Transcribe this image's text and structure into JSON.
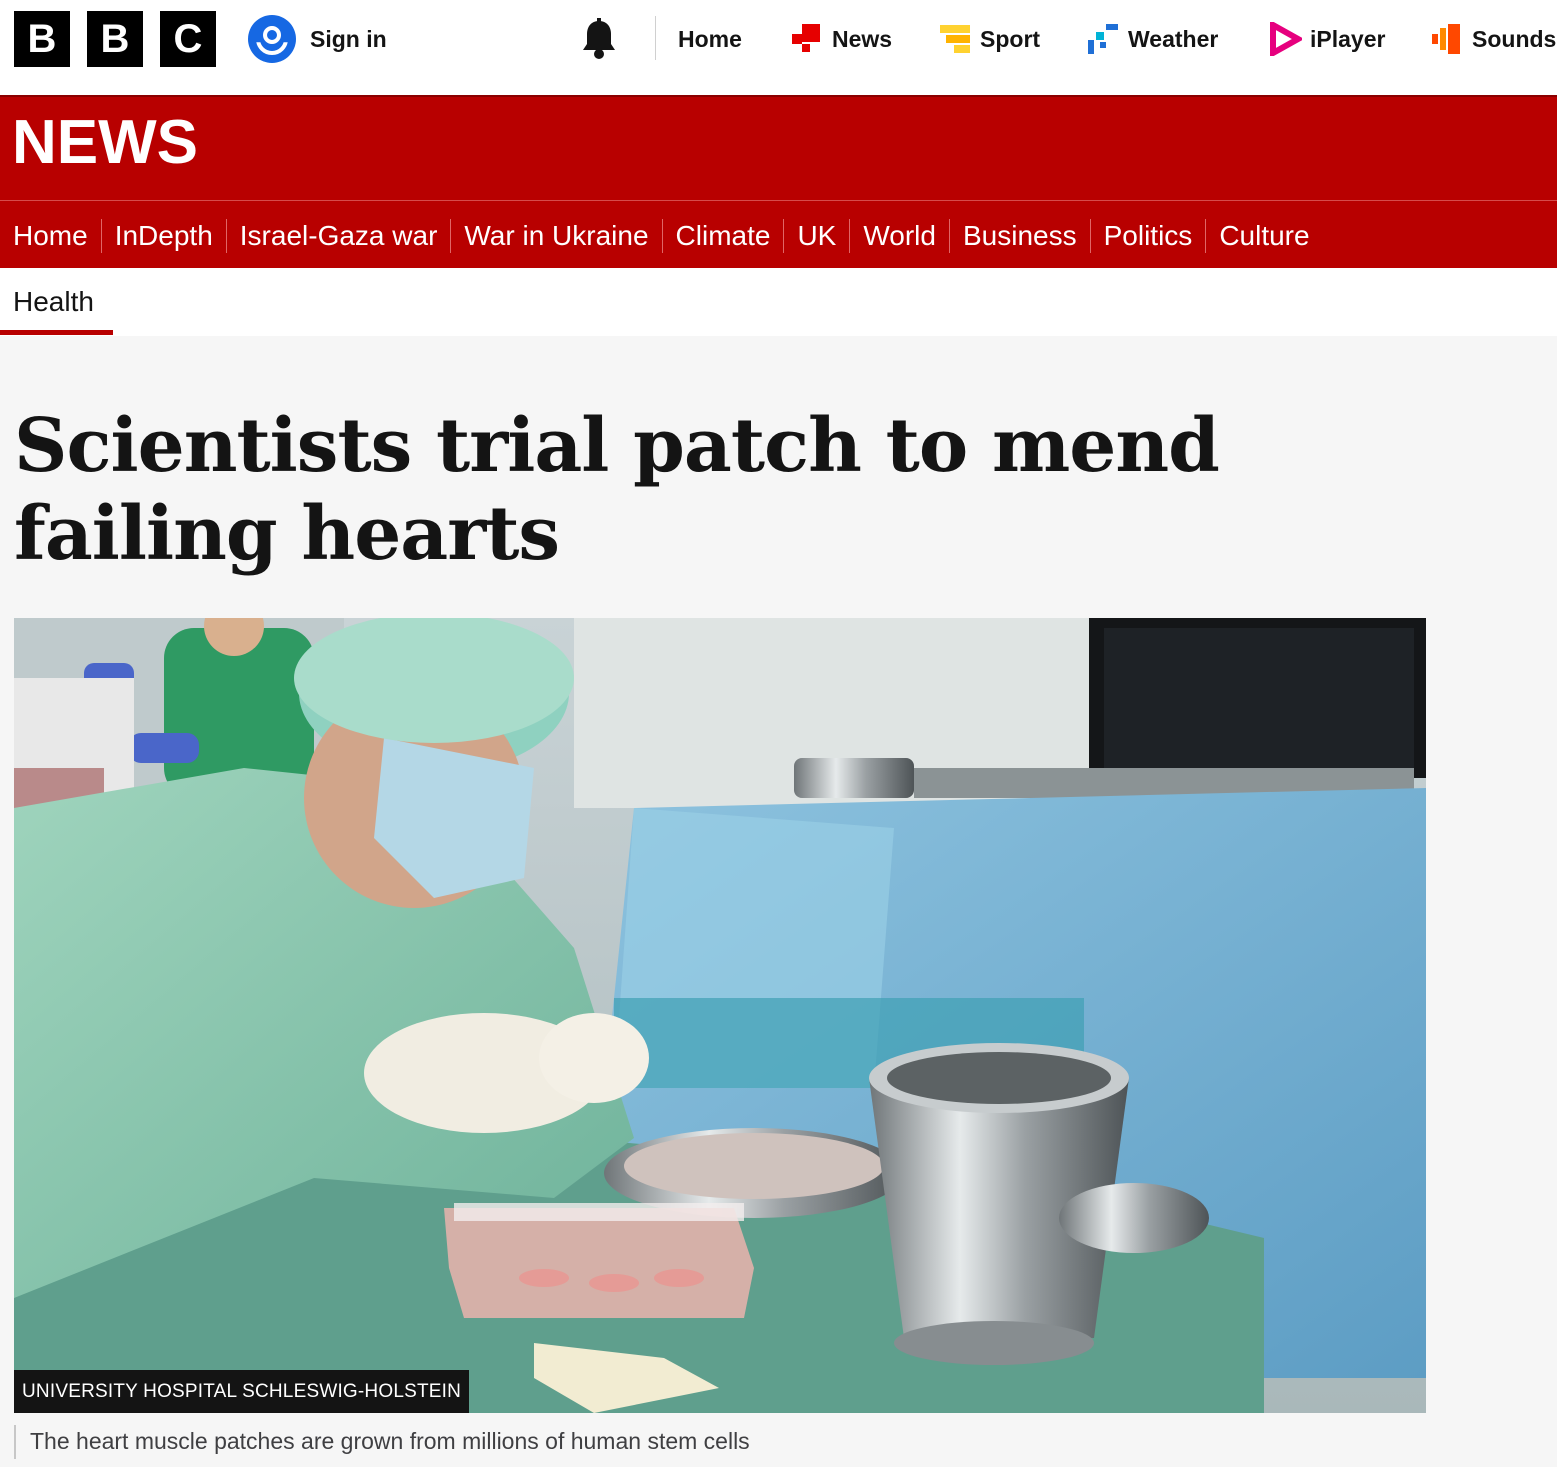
{
  "global_nav": {
    "logo_letters": [
      "B",
      "B",
      "C"
    ],
    "sign_in": "Sign in",
    "links": [
      {
        "label": "Home",
        "icon": "none"
      },
      {
        "label": "News",
        "icon": "news-icon",
        "color": "#e60000"
      },
      {
        "label": "Sport",
        "icon": "sport-icon",
        "color": "#ffd230"
      },
      {
        "label": "Weather",
        "icon": "weather-icon",
        "color": "#1f6fd6"
      },
      {
        "label": "iPlayer",
        "icon": "iplayer-icon",
        "color": "#e6007e"
      },
      {
        "label": "Sounds",
        "icon": "sounds-icon",
        "color": "#ff4800"
      }
    ]
  },
  "news_banner": {
    "title": "NEWS",
    "color": "#b80000",
    "sections": [
      "Home",
      "InDepth",
      "Israel-Gaza war",
      "War in Ukraine",
      "Climate",
      "UK",
      "World",
      "Business",
      "Politics",
      "Culture"
    ]
  },
  "sub_nav": {
    "active": "Health"
  },
  "article": {
    "headline": "Scientists trial patch to mend failing hearts",
    "image_credit": "UNIVERSITY HOSPITAL SCHLESWIG-HOLSTEIN",
    "image_caption": "The heart muscle patches are grown from millions of human stem cells"
  }
}
